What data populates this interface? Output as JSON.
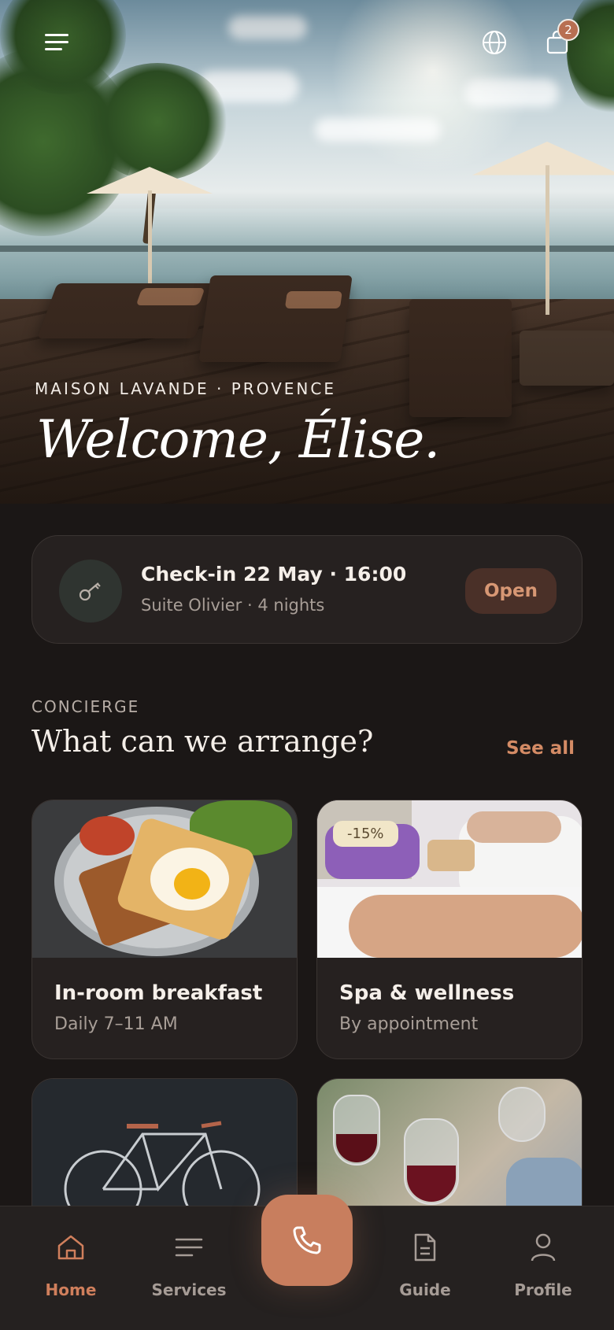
{
  "header": {
    "menu_icon": "hamburger-menu-icon",
    "globe_icon": "globe-icon",
    "bag_icon": "shopping-bag-icon",
    "bag_count": "2"
  },
  "hero": {
    "kicker": "MAISON LAVANDE · PROVENCE",
    "title": "Welcome,  Élise."
  },
  "checkin": {
    "icon": "key-icon",
    "title": "Check-in 22 May · 16:00",
    "subtitle": "Suite Olivier · 4 nights",
    "button": "Open"
  },
  "concierge": {
    "kicker": "CONCIERGE",
    "title": "What can we arrange?",
    "see_all": "See all",
    "cards": [
      {
        "title": "In-room breakfast",
        "subtitle": "Daily 7–11 AM"
      },
      {
        "title": "Spa & wellness",
        "subtitle": "By appointment",
        "badge": "-15%"
      }
    ]
  },
  "nav": {
    "items": [
      {
        "label": "Home",
        "icon": "home-icon"
      },
      {
        "label": "Services",
        "icon": "menu-lines-icon"
      },
      {
        "label": "Guide",
        "icon": "document-icon"
      },
      {
        "label": "Profile",
        "icon": "user-icon"
      }
    ],
    "call_icon": "phone-icon"
  },
  "colors": {
    "background": "#1b1716",
    "card": "#262120",
    "accent": "#c87e5e",
    "accent_text": "#d48b65"
  }
}
